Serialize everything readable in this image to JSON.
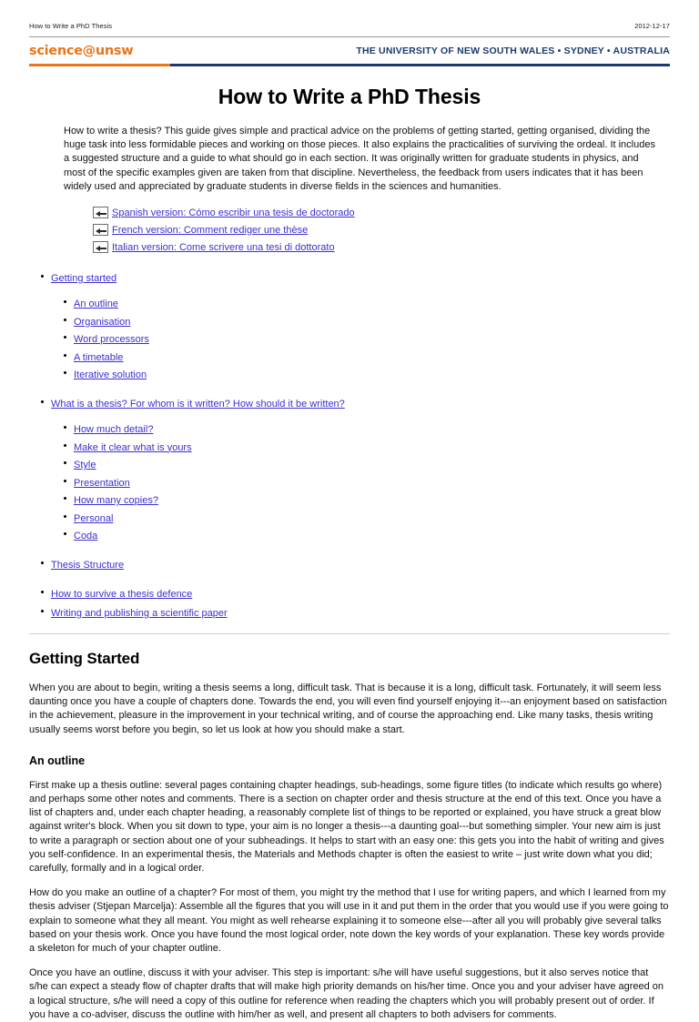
{
  "print_header": {
    "title": "How to Write a PhD Thesis",
    "date": "2012-12-17"
  },
  "banner": {
    "logo": "science@unsw",
    "tagline": "THE UNIVERSITY OF NEW SOUTH WALES • SYDNEY • AUSTRALIA",
    "logo_color": "#e8761b",
    "tagline_color": "#1b3a6b"
  },
  "doc": {
    "title": "How to Write a PhD Thesis",
    "intro": "How to write a thesis? This guide gives simple and practical advice on the problems of getting started, getting organised, dividing the huge task into less formidable pieces and working on those pieces. It also explains the practicalities of surviving the ordeal. It includes a suggested structure and a guide to what should go in each section. It was originally written for graduate students in physics, and most of the specific examples given are taken from that discipline. Nevertheless, the feedback from users indicates that it has been widely used and appreciated by graduate students in diverse fields in the sciences and humanities."
  },
  "translations": [
    {
      "icon": "broken-image-icon",
      "label": "Spanish version: Cómo escribir una tesis de doctorado"
    },
    {
      "icon": "broken-image-icon",
      "label": "French version: Comment rediger une thèse"
    },
    {
      "icon": "broken-image-icon",
      "label": "Italian version: Come scrivere una tesi di dottorato"
    }
  ],
  "toc": {
    "getting_started": "Getting started",
    "getting_started_children": [
      "An outline",
      "Organisation",
      "Word processors",
      "A timetable",
      "Iterative solution"
    ],
    "what_is_thesis": "What is a thesis? For whom is it written? How should it be written?",
    "what_is_thesis_children": [
      "How much detail?",
      "Make it clear what is yours",
      "Style",
      "Presentation",
      "How many copies?",
      "Personal",
      "Coda"
    ],
    "thesis_structure": "Thesis Structure",
    "survive_defence": "How to survive a thesis defence",
    "writing_publishing": "Writing and publishing a scientific paper"
  },
  "sections": {
    "getting_started": {
      "heading": "Getting Started",
      "paragraph": "When you are about to begin, writing a thesis seems a long, difficult task. That is because it is a long, difficult task. Fortunately, it will seem less daunting once you have a couple of chapters done. Towards the end, you will even find yourself enjoying it---an enjoyment based on satisfaction in the achievement, pleasure in the improvement in your technical writing, and of course the approaching end. Like many tasks, thesis writing usually seems worst before you begin, so let us look at how you should make a start."
    },
    "an_outline": {
      "heading": "An outline",
      "paragraph1": "First make up a thesis outline: several pages containing chapter headings, sub-headings, some figure titles (to indicate which results go where) and perhaps some other notes and comments. There is a section on chapter order and thesis structure at the end of this text. Once you have a list of chapters and, under each chapter heading, a reasonably complete list of things to be reported or explained, you have struck a great blow against writer's block. When you sit down to type, your aim is no longer a thesis---a daunting goal---but something simpler. Your new aim is just to write a paragraph or section about one of your subheadings. It helps to start with an easy one: this gets you into the habit of writing and gives you self-confidence. In an experimental thesis, the Materials and Methods chapter is often the easiest to write – just write down what you did; carefully, formally and in a logical order.",
      "paragraph2": "How do you make an outline of a chapter? For most of them, you might try the method that I use for writing papers, and which I learned from my thesis adviser (Stjepan Marcelja): Assemble all the figures that you will use in it and put them in the order that you would use if you were going to explain to someone what they all meant. You might as well rehearse explaining it to someone else---after all you will probably give several talks based on your thesis work. Once you have found the most logical order, note down the key words of your explanation. These key words provide a skeleton for much of your chapter outline.",
      "paragraph3": "Once you have an outline, discuss it with your adviser. This step is important: s/he will have useful suggestions, but it also serves notice that s/he can expect a steady flow of chapter drafts that will make high priority demands on his/her time. Once you and your adviser have agreed on a logical structure, s/he will need a copy of this outline for reference when reading the chapters which you will probably present out of order. If you have a co-adviser, discuss the outline with him/her as well, and present all chapters to both advisers for comments."
    }
  },
  "colors": {
    "link": "#3b2fd0",
    "rule": "#cfcfcf"
  }
}
